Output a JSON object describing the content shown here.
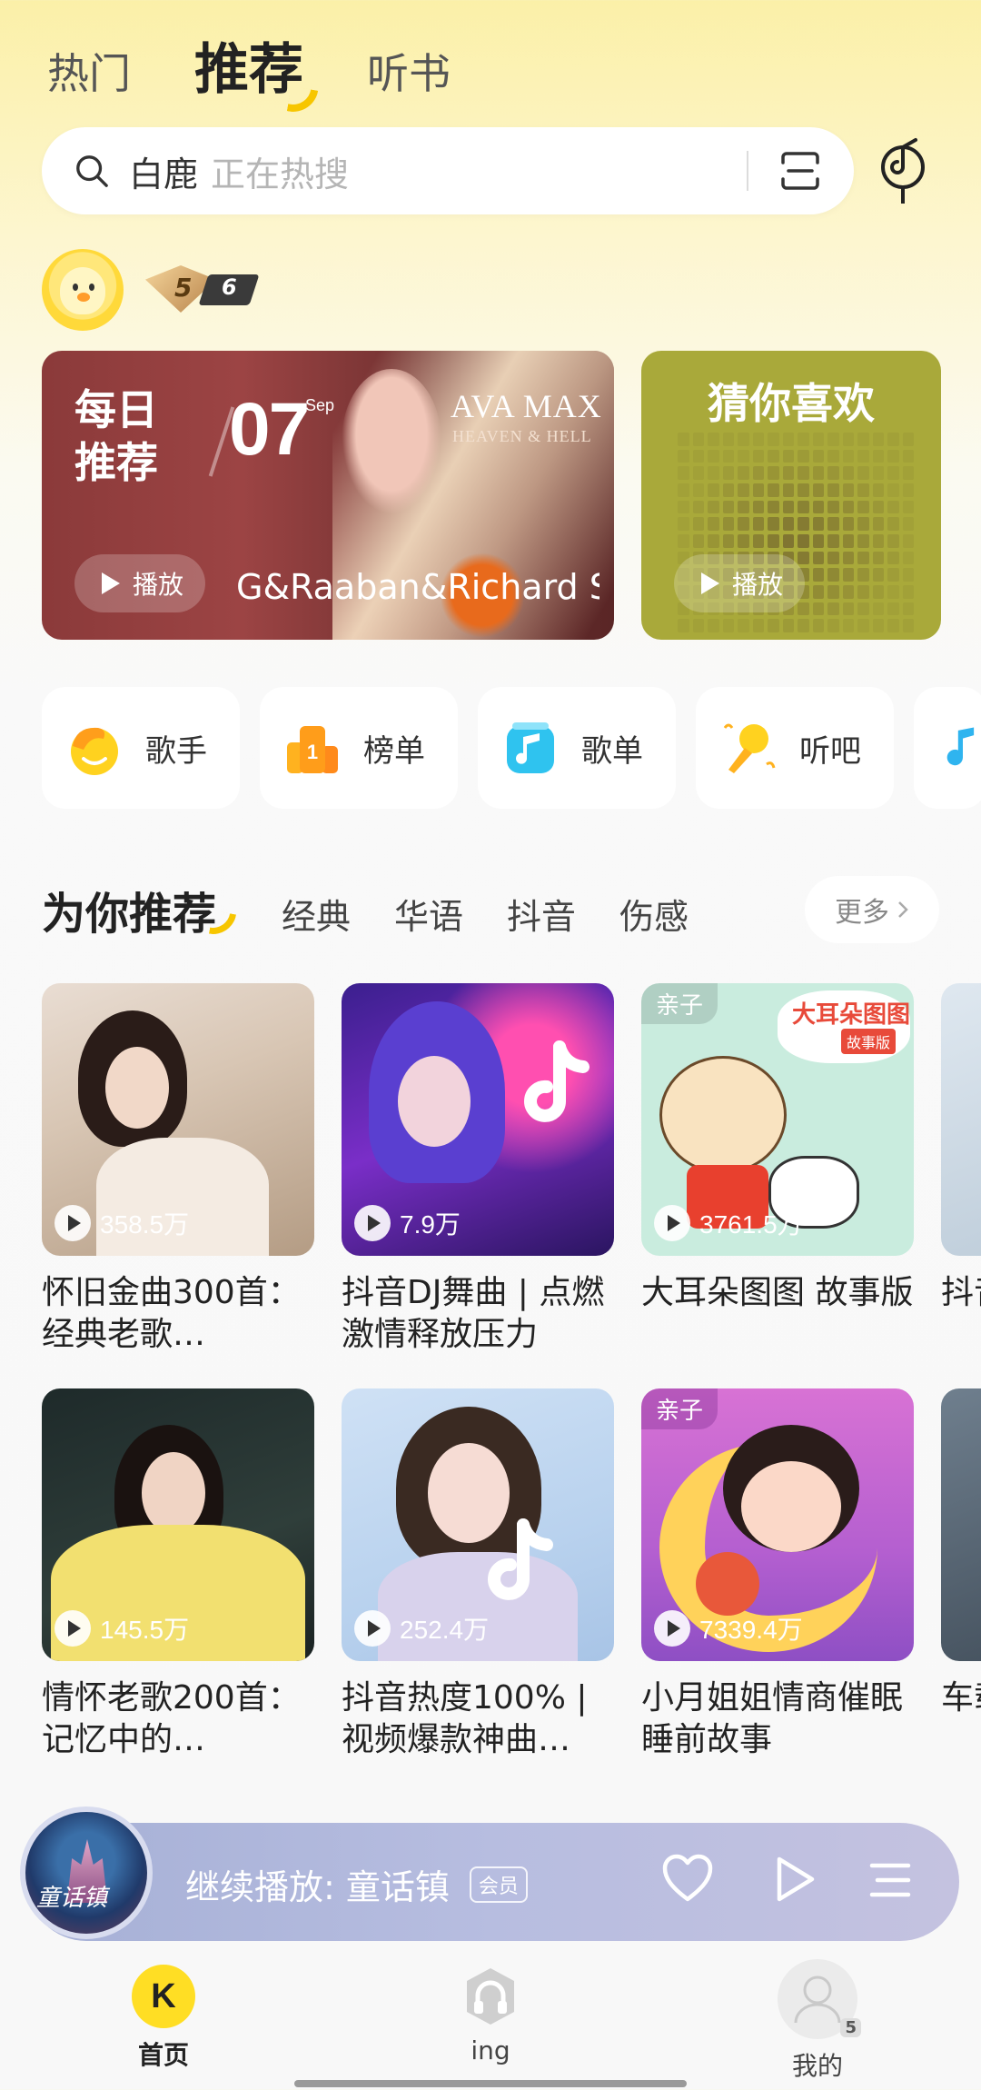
{
  "top_tabs": [
    {
      "label": "热门"
    },
    {
      "label": "推荐"
    },
    {
      "label": "听书"
    }
  ],
  "search": {
    "keyword": "白鹿",
    "hint": "正在热搜"
  },
  "user": {
    "level_main": "5",
    "level_sub": "6"
  },
  "daily": {
    "title": "每日推荐",
    "day": "07",
    "month": "Sep",
    "brand": "AVA MAX",
    "brand_sub": "HEAVEN & HELL",
    "artist_text": "G&Raaban&Richard Sm",
    "play_label": "播放"
  },
  "guess": {
    "title": "猜你喜欢",
    "play_label": "播放"
  },
  "chips": [
    {
      "label": "歌手",
      "icon": "singer-icon"
    },
    {
      "label": "榜单",
      "icon": "chart-icon"
    },
    {
      "label": "歌单",
      "icon": "playlist-icon"
    },
    {
      "label": "听吧",
      "icon": "mic-icon"
    }
  ],
  "recommend": {
    "title": "为你推荐",
    "tabs": [
      "经典",
      "华语",
      "抖音",
      "伤感"
    ],
    "more": "更多"
  },
  "playlists": [
    {
      "title": "怀旧金曲300首：经典老歌…",
      "plays": "358.5万",
      "tag": ""
    },
    {
      "title": "抖音DJ舞曲 | 点燃激情释放压力",
      "plays": "7.9万",
      "tag": ""
    },
    {
      "title": "大耳朵图图 故事版",
      "plays": "3761.5万",
      "tag": "亲子",
      "badge_line1": "大耳朵图图",
      "badge_line2": "故事版"
    },
    {
      "title": "情怀老歌200首：记忆中的…",
      "plays": "145.5万",
      "tag": ""
    },
    {
      "title": "抖音热度100% | 视频爆款神曲…",
      "plays": "252.4万",
      "tag": ""
    },
    {
      "title": "小月姐姐情商催眠睡前故事",
      "plays": "7339.4万",
      "tag": "亲子"
    }
  ],
  "partial_titles": [
    "抖音准备",
    "车载神"
  ],
  "player": {
    "prefix": "继续播放:",
    "song": "童话镇",
    "vip": "会员",
    "disc_text": "童话镇"
  },
  "nav": [
    {
      "label": "首页",
      "icon_text": "K"
    },
    {
      "label": "ing"
    },
    {
      "label": "我的",
      "badge": "5"
    }
  ]
}
